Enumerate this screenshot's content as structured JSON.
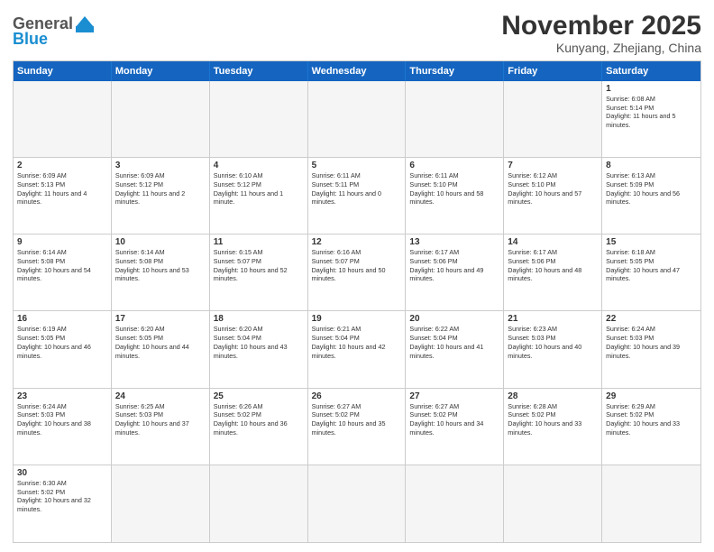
{
  "header": {
    "logo_general": "General",
    "logo_blue": "Blue",
    "month_year": "November 2025",
    "location": "Kunyang, Zhejiang, China"
  },
  "day_headers": [
    "Sunday",
    "Monday",
    "Tuesday",
    "Wednesday",
    "Thursday",
    "Friday",
    "Saturday"
  ],
  "cells": [
    {
      "day": "",
      "info": "",
      "empty": true
    },
    {
      "day": "",
      "info": "",
      "empty": true
    },
    {
      "day": "",
      "info": "",
      "empty": true
    },
    {
      "day": "",
      "info": "",
      "empty": true
    },
    {
      "day": "",
      "info": "",
      "empty": true
    },
    {
      "day": "",
      "info": "",
      "empty": true
    },
    {
      "day": "1",
      "info": "Sunrise: 6:08 AM\nSunset: 5:14 PM\nDaylight: 11 hours and 5 minutes."
    },
    {
      "day": "2",
      "info": "Sunrise: 6:09 AM\nSunset: 5:13 PM\nDaylight: 11 hours and 4 minutes."
    },
    {
      "day": "3",
      "info": "Sunrise: 6:09 AM\nSunset: 5:12 PM\nDaylight: 11 hours and 2 minutes."
    },
    {
      "day": "4",
      "info": "Sunrise: 6:10 AM\nSunset: 5:12 PM\nDaylight: 11 hours and 1 minute."
    },
    {
      "day": "5",
      "info": "Sunrise: 6:11 AM\nSunset: 5:11 PM\nDaylight: 11 hours and 0 minutes."
    },
    {
      "day": "6",
      "info": "Sunrise: 6:11 AM\nSunset: 5:10 PM\nDaylight: 10 hours and 58 minutes."
    },
    {
      "day": "7",
      "info": "Sunrise: 6:12 AM\nSunset: 5:10 PM\nDaylight: 10 hours and 57 minutes."
    },
    {
      "day": "8",
      "info": "Sunrise: 6:13 AM\nSunset: 5:09 PM\nDaylight: 10 hours and 56 minutes."
    },
    {
      "day": "9",
      "info": "Sunrise: 6:14 AM\nSunset: 5:08 PM\nDaylight: 10 hours and 54 minutes."
    },
    {
      "day": "10",
      "info": "Sunrise: 6:14 AM\nSunset: 5:08 PM\nDaylight: 10 hours and 53 minutes."
    },
    {
      "day": "11",
      "info": "Sunrise: 6:15 AM\nSunset: 5:07 PM\nDaylight: 10 hours and 52 minutes."
    },
    {
      "day": "12",
      "info": "Sunrise: 6:16 AM\nSunset: 5:07 PM\nDaylight: 10 hours and 50 minutes."
    },
    {
      "day": "13",
      "info": "Sunrise: 6:17 AM\nSunset: 5:06 PM\nDaylight: 10 hours and 49 minutes."
    },
    {
      "day": "14",
      "info": "Sunrise: 6:17 AM\nSunset: 5:06 PM\nDaylight: 10 hours and 48 minutes."
    },
    {
      "day": "15",
      "info": "Sunrise: 6:18 AM\nSunset: 5:05 PM\nDaylight: 10 hours and 47 minutes."
    },
    {
      "day": "16",
      "info": "Sunrise: 6:19 AM\nSunset: 5:05 PM\nDaylight: 10 hours and 46 minutes."
    },
    {
      "day": "17",
      "info": "Sunrise: 6:20 AM\nSunset: 5:05 PM\nDaylight: 10 hours and 44 minutes."
    },
    {
      "day": "18",
      "info": "Sunrise: 6:20 AM\nSunset: 5:04 PM\nDaylight: 10 hours and 43 minutes."
    },
    {
      "day": "19",
      "info": "Sunrise: 6:21 AM\nSunset: 5:04 PM\nDaylight: 10 hours and 42 minutes."
    },
    {
      "day": "20",
      "info": "Sunrise: 6:22 AM\nSunset: 5:04 PM\nDaylight: 10 hours and 41 minutes."
    },
    {
      "day": "21",
      "info": "Sunrise: 6:23 AM\nSunset: 5:03 PM\nDaylight: 10 hours and 40 minutes."
    },
    {
      "day": "22",
      "info": "Sunrise: 6:24 AM\nSunset: 5:03 PM\nDaylight: 10 hours and 39 minutes."
    },
    {
      "day": "23",
      "info": "Sunrise: 6:24 AM\nSunset: 5:03 PM\nDaylight: 10 hours and 38 minutes."
    },
    {
      "day": "24",
      "info": "Sunrise: 6:25 AM\nSunset: 5:03 PM\nDaylight: 10 hours and 37 minutes."
    },
    {
      "day": "25",
      "info": "Sunrise: 6:26 AM\nSunset: 5:02 PM\nDaylight: 10 hours and 36 minutes."
    },
    {
      "day": "26",
      "info": "Sunrise: 6:27 AM\nSunset: 5:02 PM\nDaylight: 10 hours and 35 minutes."
    },
    {
      "day": "27",
      "info": "Sunrise: 6:27 AM\nSunset: 5:02 PM\nDaylight: 10 hours and 34 minutes."
    },
    {
      "day": "28",
      "info": "Sunrise: 6:28 AM\nSunset: 5:02 PM\nDaylight: 10 hours and 33 minutes."
    },
    {
      "day": "29",
      "info": "Sunrise: 6:29 AM\nSunset: 5:02 PM\nDaylight: 10 hours and 33 minutes."
    },
    {
      "day": "30",
      "info": "Sunrise: 6:30 AM\nSunset: 5:02 PM\nDaylight: 10 hours and 32 minutes."
    },
    {
      "day": "",
      "info": "",
      "empty": true
    },
    {
      "day": "",
      "info": "",
      "empty": true
    },
    {
      "day": "",
      "info": "",
      "empty": true
    },
    {
      "day": "",
      "info": "",
      "empty": true
    },
    {
      "day": "",
      "info": "",
      "empty": true
    },
    {
      "day": "",
      "info": "",
      "empty": true
    }
  ]
}
